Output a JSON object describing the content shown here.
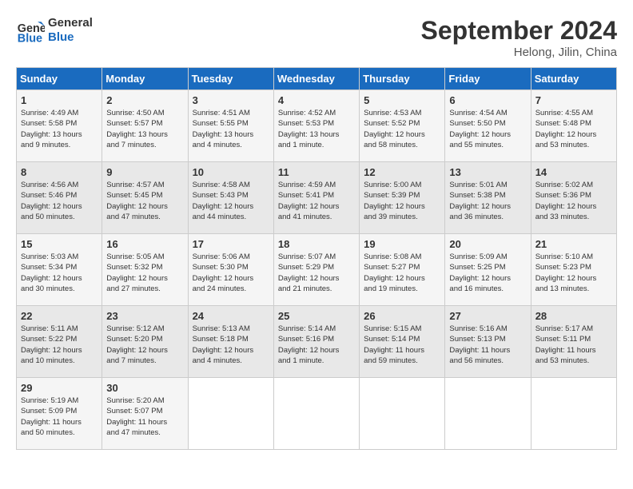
{
  "logo": {
    "text_general": "General",
    "text_blue": "Blue"
  },
  "title": "September 2024",
  "location": "Helong, Jilin, China",
  "days_header": [
    "Sunday",
    "Monday",
    "Tuesday",
    "Wednesday",
    "Thursday",
    "Friday",
    "Saturday"
  ],
  "weeks": [
    [
      {
        "day": "1",
        "info": "Sunrise: 4:49 AM\nSunset: 5:58 PM\nDaylight: 13 hours\nand 9 minutes."
      },
      {
        "day": "2",
        "info": "Sunrise: 4:50 AM\nSunset: 5:57 PM\nDaylight: 13 hours\nand 7 minutes."
      },
      {
        "day": "3",
        "info": "Sunrise: 4:51 AM\nSunset: 5:55 PM\nDaylight: 13 hours\nand 4 minutes."
      },
      {
        "day": "4",
        "info": "Sunrise: 4:52 AM\nSunset: 5:53 PM\nDaylight: 13 hours\nand 1 minute."
      },
      {
        "day": "5",
        "info": "Sunrise: 4:53 AM\nSunset: 5:52 PM\nDaylight: 12 hours\nand 58 minutes."
      },
      {
        "day": "6",
        "info": "Sunrise: 4:54 AM\nSunset: 5:50 PM\nDaylight: 12 hours\nand 55 minutes."
      },
      {
        "day": "7",
        "info": "Sunrise: 4:55 AM\nSunset: 5:48 PM\nDaylight: 12 hours\nand 53 minutes."
      }
    ],
    [
      {
        "day": "8",
        "info": "Sunrise: 4:56 AM\nSunset: 5:46 PM\nDaylight: 12 hours\nand 50 minutes."
      },
      {
        "day": "9",
        "info": "Sunrise: 4:57 AM\nSunset: 5:45 PM\nDaylight: 12 hours\nand 47 minutes."
      },
      {
        "day": "10",
        "info": "Sunrise: 4:58 AM\nSunset: 5:43 PM\nDaylight: 12 hours\nand 44 minutes."
      },
      {
        "day": "11",
        "info": "Sunrise: 4:59 AM\nSunset: 5:41 PM\nDaylight: 12 hours\nand 41 minutes."
      },
      {
        "day": "12",
        "info": "Sunrise: 5:00 AM\nSunset: 5:39 PM\nDaylight: 12 hours\nand 39 minutes."
      },
      {
        "day": "13",
        "info": "Sunrise: 5:01 AM\nSunset: 5:38 PM\nDaylight: 12 hours\nand 36 minutes."
      },
      {
        "day": "14",
        "info": "Sunrise: 5:02 AM\nSunset: 5:36 PM\nDaylight: 12 hours\nand 33 minutes."
      }
    ],
    [
      {
        "day": "15",
        "info": "Sunrise: 5:03 AM\nSunset: 5:34 PM\nDaylight: 12 hours\nand 30 minutes."
      },
      {
        "day": "16",
        "info": "Sunrise: 5:05 AM\nSunset: 5:32 PM\nDaylight: 12 hours\nand 27 minutes."
      },
      {
        "day": "17",
        "info": "Sunrise: 5:06 AM\nSunset: 5:30 PM\nDaylight: 12 hours\nand 24 minutes."
      },
      {
        "day": "18",
        "info": "Sunrise: 5:07 AM\nSunset: 5:29 PM\nDaylight: 12 hours\nand 21 minutes."
      },
      {
        "day": "19",
        "info": "Sunrise: 5:08 AM\nSunset: 5:27 PM\nDaylight: 12 hours\nand 19 minutes."
      },
      {
        "day": "20",
        "info": "Sunrise: 5:09 AM\nSunset: 5:25 PM\nDaylight: 12 hours\nand 16 minutes."
      },
      {
        "day": "21",
        "info": "Sunrise: 5:10 AM\nSunset: 5:23 PM\nDaylight: 12 hours\nand 13 minutes."
      }
    ],
    [
      {
        "day": "22",
        "info": "Sunrise: 5:11 AM\nSunset: 5:22 PM\nDaylight: 12 hours\nand 10 minutes."
      },
      {
        "day": "23",
        "info": "Sunrise: 5:12 AM\nSunset: 5:20 PM\nDaylight: 12 hours\nand 7 minutes."
      },
      {
        "day": "24",
        "info": "Sunrise: 5:13 AM\nSunset: 5:18 PM\nDaylight: 12 hours\nand 4 minutes."
      },
      {
        "day": "25",
        "info": "Sunrise: 5:14 AM\nSunset: 5:16 PM\nDaylight: 12 hours\nand 1 minute."
      },
      {
        "day": "26",
        "info": "Sunrise: 5:15 AM\nSunset: 5:14 PM\nDaylight: 11 hours\nand 59 minutes."
      },
      {
        "day": "27",
        "info": "Sunrise: 5:16 AM\nSunset: 5:13 PM\nDaylight: 11 hours\nand 56 minutes."
      },
      {
        "day": "28",
        "info": "Sunrise: 5:17 AM\nSunset: 5:11 PM\nDaylight: 11 hours\nand 53 minutes."
      }
    ],
    [
      {
        "day": "29",
        "info": "Sunrise: 5:19 AM\nSunset: 5:09 PM\nDaylight: 11 hours\nand 50 minutes."
      },
      {
        "day": "30",
        "info": "Sunrise: 5:20 AM\nSunset: 5:07 PM\nDaylight: 11 hours\nand 47 minutes."
      },
      {
        "day": "",
        "info": ""
      },
      {
        "day": "",
        "info": ""
      },
      {
        "day": "",
        "info": ""
      },
      {
        "day": "",
        "info": ""
      },
      {
        "day": "",
        "info": ""
      }
    ]
  ]
}
